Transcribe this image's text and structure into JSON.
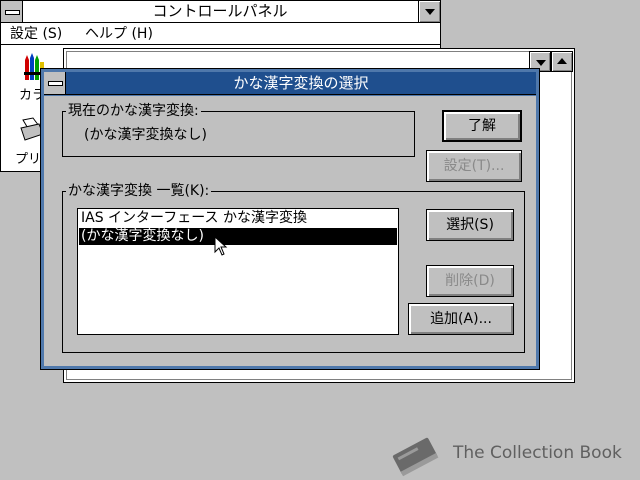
{
  "control_panel": {
    "title": "コントロールパネル",
    "menu": [
      "設定 (S)",
      "ヘルプ (H)"
    ],
    "icons": [
      {
        "label": "カラ",
        "icon": "color-crayons-icon"
      },
      {
        "label": "",
        "icon": "font-aa-icon"
      },
      {
        "label": "",
        "icon": "keyboard-icon"
      },
      {
        "label": "",
        "icon": "mouse-icon"
      },
      {
        "label": "",
        "icon": "desktop-icon"
      },
      {
        "label": "",
        "icon": "kanji-input-icon"
      },
      {
        "label": "プリ",
        "icon": "printer-icon"
      }
    ]
  },
  "dialog": {
    "title": "かな漢字変換の選択",
    "current_group_label": "現在のかな漢字変換:",
    "current_value": "(かな漢字変換なし)",
    "list_group_label": "かな漢字変換 一覧(K):",
    "list_items": [
      {
        "label": "IAS インターフェース かな漢字変換",
        "selected": false
      },
      {
        "label": "(かな漢字変換なし)",
        "selected": true
      }
    ],
    "buttons": {
      "ok": "了解",
      "settings": "設定(T)...",
      "select": "選択(S)",
      "delete": "削除(D)",
      "add": "追加(A)..."
    }
  },
  "watermark": {
    "text": "The Collection Book",
    "icon": "book-icon"
  }
}
